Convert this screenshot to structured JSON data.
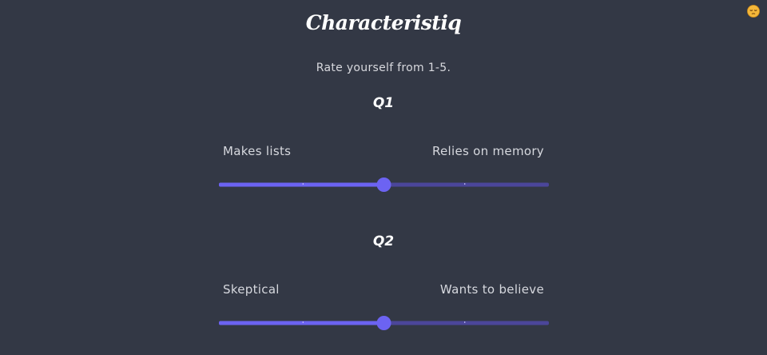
{
  "app": {
    "title": "Characteristiq",
    "subtitle": "Rate yourself from 1-5.",
    "avatar_icon": "sleepy-face-icon"
  },
  "colors": {
    "background": "#333845",
    "accent": "#6c63f2",
    "track_rest": "#4b469a"
  },
  "questions": [
    {
      "title": "Q1",
      "left_label": "Makes lists",
      "right_label": "Relies on memory",
      "min": 1,
      "max": 5,
      "value": 3
    },
    {
      "title": "Q2",
      "left_label": "Skeptical",
      "right_label": "Wants to believe",
      "min": 1,
      "max": 5,
      "value": 3
    }
  ]
}
